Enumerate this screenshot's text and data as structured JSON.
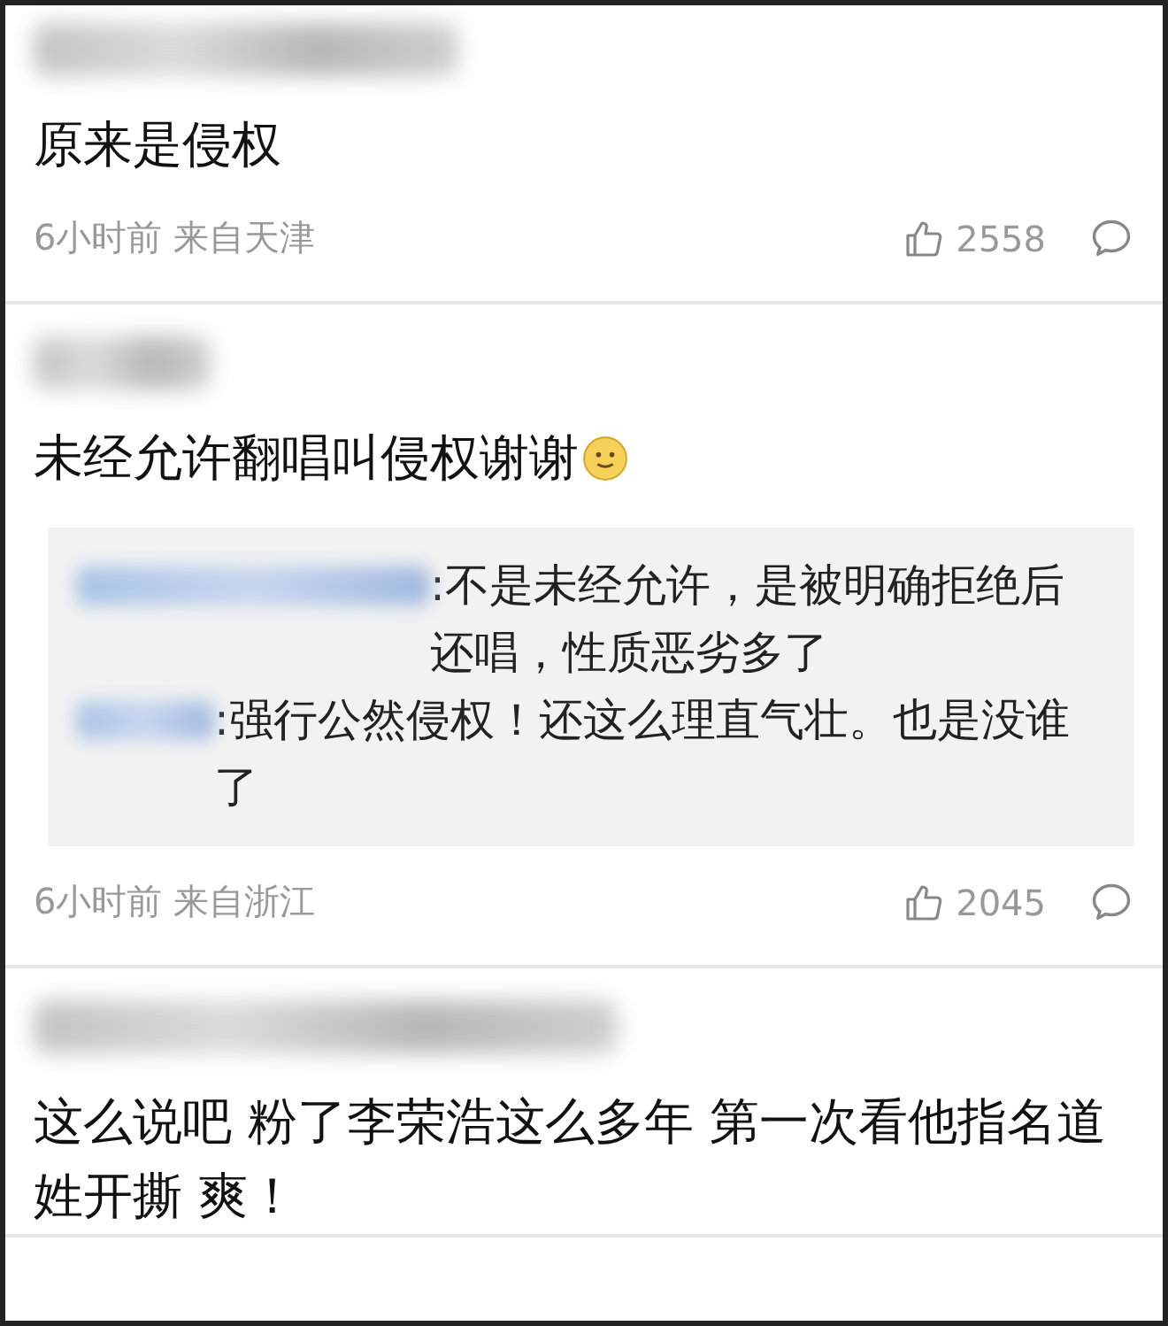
{
  "comments": [
    {
      "text": "原来是侵权",
      "meta": {
        "time": "6小时前",
        "location": "来自天津",
        "likes": "2558"
      }
    },
    {
      "text": "未经允许翻唱叫侵权谢谢",
      "emoji": true,
      "replies": [
        {
          "text": ":不是未经允许，是被明确拒绝后还唱，性质恶劣多了"
        },
        {
          "text": ":强行公然侵权！还这么理直气壮。也是没谁了"
        }
      ],
      "meta": {
        "time": "6小时前",
        "location": "来自浙江",
        "likes": "2045"
      }
    },
    {
      "text": "这么说吧 粉了李荣浩这么多年 第一次看他指名道姓开撕 爽！"
    }
  ]
}
